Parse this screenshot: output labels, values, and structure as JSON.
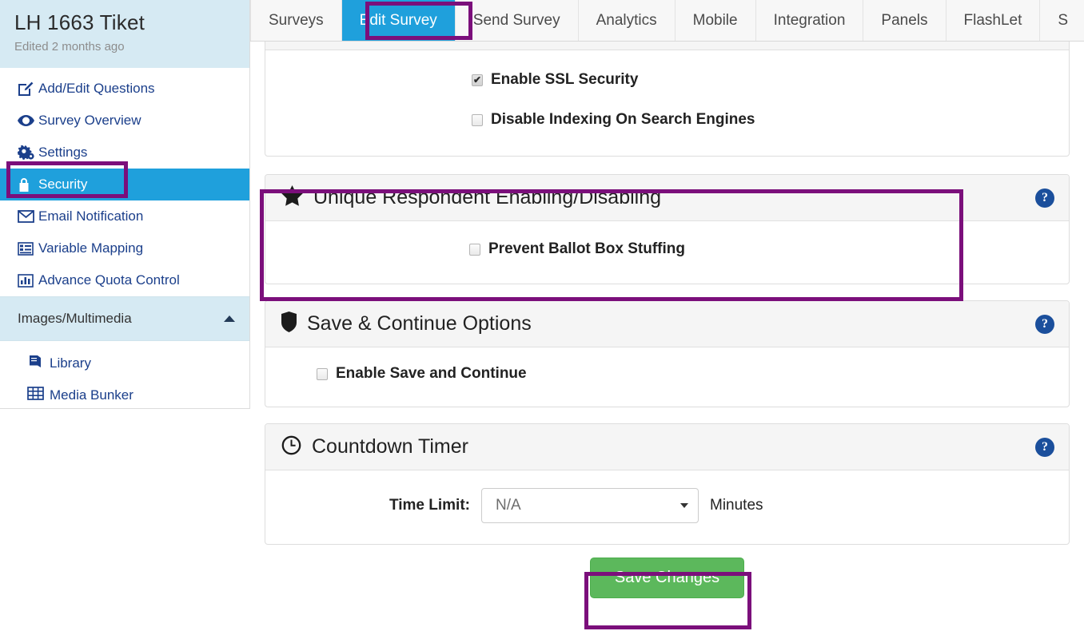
{
  "survey": {
    "title": "LH 1663 Tiket",
    "edited": "Edited 2 months ago"
  },
  "sidebar": {
    "items": [
      {
        "label": "Add/Edit Questions",
        "icon": "pencil-square-icon",
        "active": false
      },
      {
        "label": "Survey Overview",
        "icon": "eye-icon",
        "active": false
      },
      {
        "label": "Settings",
        "icon": "gears-icon",
        "active": false
      },
      {
        "label": "Security",
        "icon": "lock-icon",
        "active": true
      },
      {
        "label": "Email Notification",
        "icon": "envelope-icon",
        "active": false
      },
      {
        "label": "Variable Mapping",
        "icon": "list-icon",
        "active": false
      },
      {
        "label": "Advance Quota Control",
        "icon": "bar-chart-icon",
        "active": false
      }
    ],
    "section": {
      "label": "Images/Multimedia",
      "expanded": true
    },
    "sub_items": [
      {
        "label": "Library",
        "icon": "book-icon"
      },
      {
        "label": "Media Bunker",
        "icon": "film-icon"
      }
    ]
  },
  "topnav": {
    "tabs": [
      {
        "label": "Surveys",
        "active": false
      },
      {
        "label": "Edit Survey",
        "active": true
      },
      {
        "label": "Send Survey",
        "active": false
      },
      {
        "label": "Analytics",
        "active": false
      },
      {
        "label": "Mobile",
        "active": false
      },
      {
        "label": "Integration",
        "active": false
      },
      {
        "label": "Panels",
        "active": false
      },
      {
        "label": "FlashLet",
        "active": false
      },
      {
        "label": "S",
        "active": false
      }
    ]
  },
  "main": {
    "panel_ssl": {
      "checkboxes": [
        {
          "label": "Enable SSL Security",
          "checked": true
        },
        {
          "label": "Disable Indexing On Search Engines",
          "checked": false
        }
      ]
    },
    "panel_unique": {
      "title": "Unique Respondent Enabling/Disabling",
      "icon": "star-icon",
      "help": "?",
      "checkboxes": [
        {
          "label": "Prevent Ballot Box Stuffing",
          "checked": false
        }
      ]
    },
    "panel_save": {
      "title": "Save & Continue Options",
      "icon": "shield-icon",
      "help": "?",
      "checkboxes": [
        {
          "label": "Enable Save and Continue",
          "checked": false
        }
      ]
    },
    "panel_timer": {
      "title": "Countdown Timer",
      "icon": "clock-icon",
      "help": "?",
      "time_limit_label": "Time Limit:",
      "time_limit_value": "N/A",
      "units": "Minutes"
    },
    "save_button": "Save Changes"
  },
  "colors": {
    "accent_blue": "#1fa0dc",
    "sidebar_header": "#d6eaf3",
    "link_blue": "#1b3f8b",
    "annotation_purple": "#7b0f7b",
    "save_green": "#5cb85c",
    "help_navy": "#1b4f9c"
  }
}
